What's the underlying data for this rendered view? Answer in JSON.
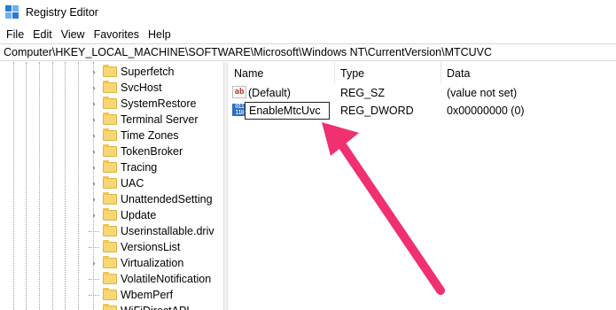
{
  "window": {
    "title": "Registry Editor"
  },
  "menu": [
    "File",
    "Edit",
    "View",
    "Favorites",
    "Help"
  ],
  "address": "Computer\\HKEY_LOCAL_MACHINE\\SOFTWARE\\Microsoft\\Windows NT\\CurrentVersion\\MTCUVC",
  "tree": {
    "items": [
      {
        "label": "Superfetch",
        "expandable": true
      },
      {
        "label": "SvcHost",
        "expandable": true
      },
      {
        "label": "SystemRestore",
        "expandable": true
      },
      {
        "label": "Terminal Server",
        "expandable": true
      },
      {
        "label": "Time Zones",
        "expandable": true
      },
      {
        "label": "TokenBroker",
        "expandable": true
      },
      {
        "label": "Tracing",
        "expandable": true
      },
      {
        "label": "UAC",
        "expandable": true
      },
      {
        "label": "UnattendedSetting",
        "expandable": true
      },
      {
        "label": "Update",
        "expandable": true
      },
      {
        "label": "Userinstallable.driv",
        "expandable": false
      },
      {
        "label": "VersionsList",
        "expandable": false
      },
      {
        "label": "Virtualization",
        "expandable": true
      },
      {
        "label": "VolatileNotification",
        "expandable": false
      },
      {
        "label": "WbemPerf",
        "expandable": false
      },
      {
        "label": "WiFiDirectAPI",
        "expandable": false
      }
    ]
  },
  "values": {
    "headers": {
      "name": "Name",
      "type": "Type",
      "data": "Data"
    },
    "rows": [
      {
        "icon": "string-value-icon",
        "name": "(Default)",
        "type": "REG_SZ",
        "data": "(value not set)"
      },
      {
        "icon": "binary-value-icon",
        "name": "EnableMtcUvc",
        "type": "REG_DWORD",
        "data": "0x00000000 (0)",
        "editing": true
      }
    ]
  },
  "annotation": {
    "color": "#f0306f"
  }
}
